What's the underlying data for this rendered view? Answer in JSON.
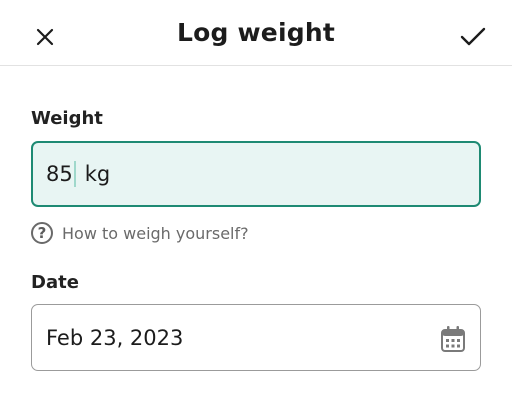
{
  "header": {
    "title": "Log weight",
    "close_icon": "close-icon",
    "confirm_icon": "checkmark-icon"
  },
  "weight": {
    "label": "Weight",
    "value": "85",
    "unit": "kg"
  },
  "help": {
    "icon_glyph": "?",
    "text": "How to weigh yourself?"
  },
  "date": {
    "label": "Date",
    "value": "Feb 23, 2023",
    "icon": "calendar-icon"
  },
  "colors": {
    "accent": "#1e8a73",
    "input_active_bg": "#e8f5f3"
  }
}
